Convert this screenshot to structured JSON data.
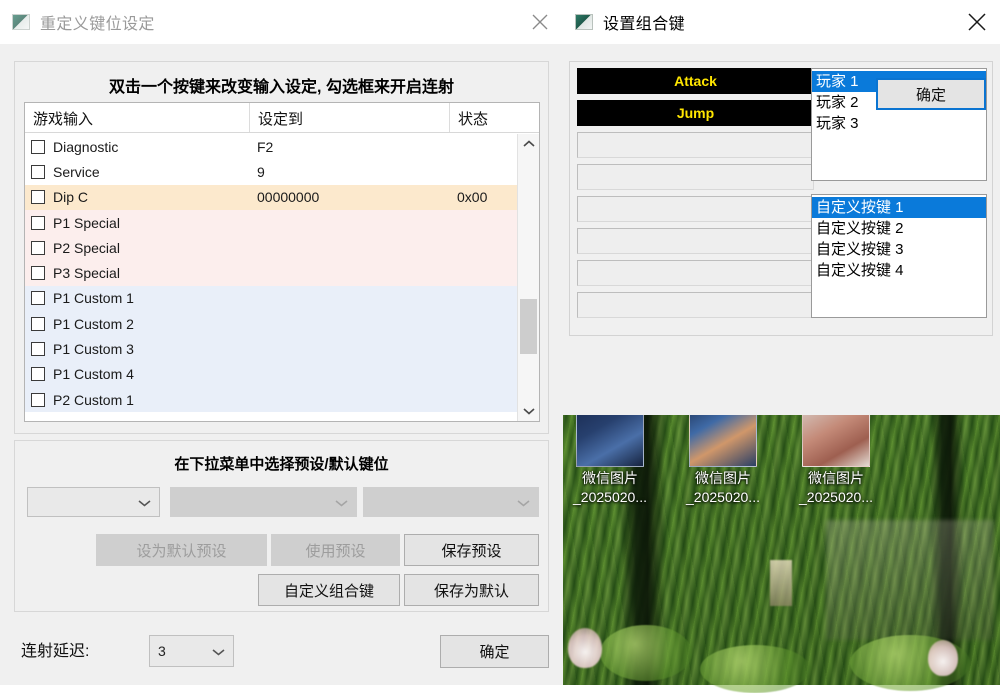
{
  "desktop": {
    "icons": [
      {
        "name": "微信图片",
        "name2": "_2025020...",
        "thumb": "a"
      },
      {
        "name": "微信图片",
        "name2": "_2025020...",
        "thumb": "b"
      },
      {
        "name": "微信图片",
        "name2": "_2025020...",
        "thumb": "c"
      }
    ]
  },
  "remap_window": {
    "title": "重定义键位设定",
    "close_label": "×",
    "instruction": "双击一个按键来改变输入设定, 勾选框来开启连射",
    "table": {
      "headers": [
        "游戏输入",
        "设定到",
        "状态"
      ],
      "rows": [
        {
          "input": "Diagnostic",
          "assigned": "F2",
          "status": "",
          "tint": ""
        },
        {
          "input": "Service",
          "assigned": "9",
          "status": "",
          "tint": ""
        },
        {
          "input": "Dip C",
          "assigned": "00000000",
          "status": "0x00",
          "tint": "tint-orange"
        },
        {
          "input": "P1 Special",
          "assigned": "",
          "status": "",
          "tint": "tint-pink"
        },
        {
          "input": "P2 Special",
          "assigned": "",
          "status": "",
          "tint": "tint-pink"
        },
        {
          "input": "P3 Special",
          "assigned": "",
          "status": "",
          "tint": "tint-pink"
        },
        {
          "input": "P1 Custom 1",
          "assigned": "",
          "status": "",
          "tint": "tint-blue"
        },
        {
          "input": "P1 Custom 2",
          "assigned": "",
          "status": "",
          "tint": "tint-blue"
        },
        {
          "input": "P1 Custom 3",
          "assigned": "",
          "status": "",
          "tint": "tint-blue"
        },
        {
          "input": "P1 Custom 4",
          "assigned": "",
          "status": "",
          "tint": "tint-blue"
        },
        {
          "input": "P2 Custom 1",
          "assigned": "",
          "status": "",
          "tint": "tint-blue"
        }
      ]
    },
    "preset_group": {
      "caption": "在下拉菜单中选择预设/默认键位",
      "combos": [
        {
          "value": "",
          "enabled": true
        },
        {
          "value": "",
          "enabled": false
        },
        {
          "value": "",
          "enabled": false
        }
      ],
      "buttons": [
        {
          "label": "设为默认预设",
          "enabled": false
        },
        {
          "label": "使用预设",
          "enabled": false
        },
        {
          "label": "保存预设",
          "enabled": true
        },
        {
          "label": "自定义组合键",
          "enabled": true
        },
        {
          "label": "保存为默认",
          "enabled": true
        }
      ]
    },
    "footer": {
      "delay_label": "连射延迟:",
      "delay_value": "3",
      "ok_label": "确定"
    }
  },
  "combo_window": {
    "title": "设置组合键",
    "close_label": "×",
    "slots": [
      {
        "label": "Attack",
        "filled": true
      },
      {
        "label": "Jump",
        "filled": true
      },
      {
        "label": "",
        "filled": false
      },
      {
        "label": "",
        "filled": false
      },
      {
        "label": "",
        "filled": false
      },
      {
        "label": "",
        "filled": false
      },
      {
        "label": "",
        "filled": false
      },
      {
        "label": "",
        "filled": false
      }
    ],
    "player_list": [
      {
        "label": "玩家 1",
        "selected": true
      },
      {
        "label": "玩家 2",
        "selected": false
      },
      {
        "label": "玩家 3",
        "selected": false
      }
    ],
    "custom_list": [
      {
        "label": "自定义按键 1",
        "selected": true
      },
      {
        "label": "自定义按键 2",
        "selected": false
      },
      {
        "label": "自定义按键 3",
        "selected": false
      },
      {
        "label": "自定义按键 4",
        "selected": false
      }
    ],
    "ok_label": "确定"
  },
  "colors": {
    "slot_text": "#ffe600",
    "slot_bg": "#000000",
    "selection": "#0a7ada",
    "focus_border": "#0a74d1",
    "tint_orange": "#fce9cd",
    "tint_pink": "#fceeed",
    "tint_blue": "#e9eff9"
  }
}
